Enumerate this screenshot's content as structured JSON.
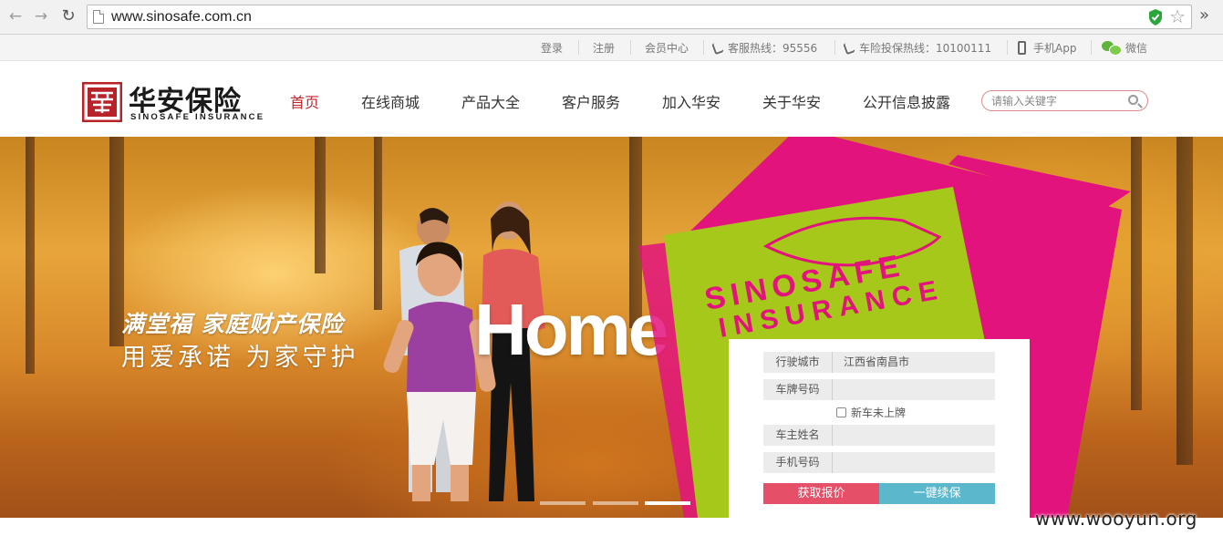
{
  "browser": {
    "url": "www.sinosafe.com.cn"
  },
  "topbar": {
    "login": "登录",
    "register": "注册",
    "member_center": "会员中心",
    "service_hotline": "客服热线：95556",
    "car_hotline": "车险投保热线：10100111",
    "mobile_app": "手机App",
    "wechat": "微信"
  },
  "logo": {
    "cn": "华安保险",
    "en": "SINOSAFE   INSURANCE"
  },
  "nav": {
    "items": [
      {
        "label": "首页",
        "active": true
      },
      {
        "label": "在线商城",
        "active": false
      },
      {
        "label": "产品大全",
        "active": false
      },
      {
        "label": "客户服务",
        "active": false
      },
      {
        "label": "加入华安",
        "active": false
      },
      {
        "label": "关于华安",
        "active": false
      },
      {
        "label": "公开信息披露",
        "active": false
      }
    ]
  },
  "search": {
    "placeholder": "请输入关键字"
  },
  "banner": {
    "title_line1": "满堂福 家庭财产保险",
    "title_line2": "用爱承诺 为家守护",
    "home_word": "Home",
    "brand_line1": "SINOSAFE",
    "brand_line2": "INSURANCE"
  },
  "quote_form": {
    "city_label": "行驶城市",
    "city_value": "江西省南昌市",
    "plate_label": "车牌号码",
    "new_car_label": "新车未上牌",
    "owner_label": "车主姓名",
    "phone_label": "手机号码",
    "quote_button": "获取报价",
    "renew_button": "一键续保"
  },
  "colors": {
    "brand_red": "#c0262d",
    "magenta": "#e2137c",
    "lime": "#a6c81b",
    "quote_pink": "#e55068",
    "renew_teal": "#5ab7cc"
  },
  "slider": {
    "count": 3,
    "active_index": 2
  },
  "watermark": "www.wooyun.org"
}
